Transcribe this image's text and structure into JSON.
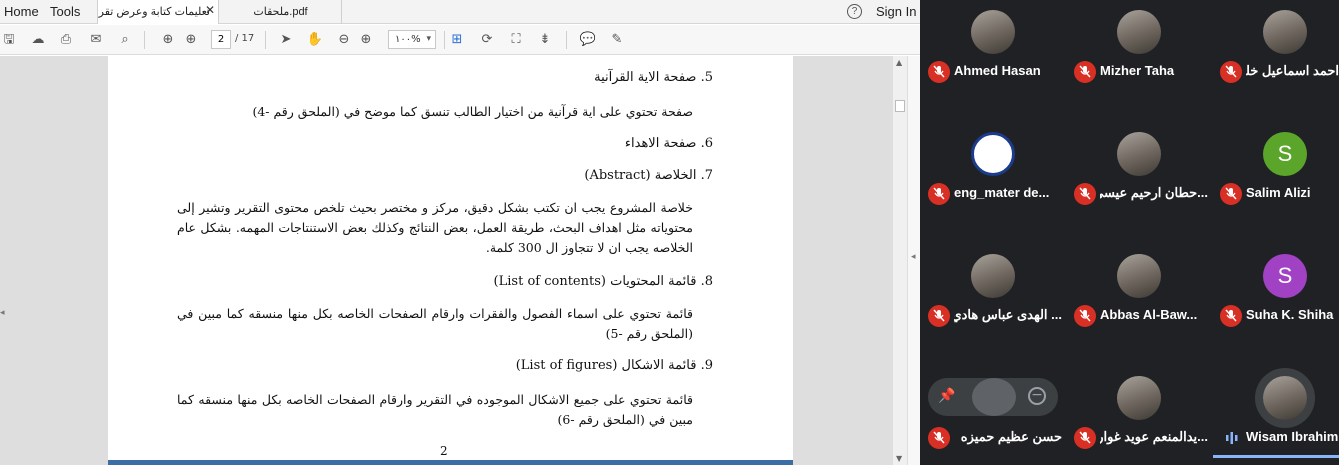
{
  "menubar": {
    "home": "Home",
    "tools": "Tools",
    "tab_active": "تعليمات كتابة وعرض تقر...",
    "tab_other": "ملحقات.pdf",
    "help": "?",
    "signin": "Sign In"
  },
  "toolbar": {
    "page_current": "2",
    "page_total": "/ 17",
    "zoom": "١٠٠%"
  },
  "document": {
    "s5_heading": "5. صفحة الاية القرآنية",
    "s5_text": "صفحة تحتوي على اية قرآنية من اختيار الطالب تنسق كما موضح في (الملحق رقم -4)",
    "s6_heading": "6. صفحة الاهداء",
    "s7_heading": "7. الخلاصة (Abstract)",
    "s7_text": "خلاصة المشروع يجب ان تكتب بشكل دقيق، مركز و مختصر بحيث تلخص محتوى التقرير وتشير إلى محتوياته مثل اهداف البحث، طريقة العمل، بعض النتائج وكذلك بعض الاستنتاجات المهمه. بشكل عام الخلاصه يجب ان لا تتجاوز ال 300 كلمة.",
    "s8_heading": "8. قائمة المحتويات (List of contents)",
    "s8_text": "قائمة تحتوي على اسماء الفصول والفقرات وارقام الصفحات الخاصه بكل منها منسقه كما مبين في (الملحق رقم -5)",
    "s9_heading": "9. قائمة الاشكال (List of figures)",
    "s9_text": "قائمة تحتوي على جميع الاشكال الموجوده في التقرير وارقام الصفحات الخاصه بكل منها منسقه كما مبين في (الملحق رقم -6)",
    "page_number": "2"
  },
  "participants": [
    {
      "name": "Ahmed Hasan",
      "avatar": "photo",
      "muted": true
    },
    {
      "name": "Mizher Taha",
      "avatar": "photo",
      "muted": true
    },
    {
      "name": "احمد اسماعيل خليل",
      "avatar": "photo",
      "muted": true
    },
    {
      "name": "eng_mater de...",
      "avatar": "logo",
      "muted": true
    },
    {
      "name": "...حطان ارحيم عيسى",
      "avatar": "photo",
      "muted": true
    },
    {
      "name": "Salim Alizi",
      "avatar": "S",
      "avatar_color": "#5aa52a",
      "muted": true
    },
    {
      "name": "... الهدى عباس هادي",
      "avatar": "photo",
      "muted": true
    },
    {
      "name": "Abbas Al-Baw...",
      "avatar": "photo",
      "muted": true
    },
    {
      "name": "Suha K. Shiha",
      "avatar": "S",
      "avatar_color": "#a142c4",
      "muted": true
    },
    {
      "name": "حسن عظيم حميزه",
      "avatar": "photo",
      "muted": true
    },
    {
      "name": "...يدالمنعم عويد غوار",
      "avatar": "photo",
      "muted": true
    },
    {
      "name": "Wisam Ibrahim",
      "avatar": "photo",
      "muted": false,
      "speaking": true
    }
  ],
  "colors": {
    "mic_muted": "#d93025",
    "speaker_highlight": "#8ab4f8",
    "panel_bg": "#202124"
  }
}
